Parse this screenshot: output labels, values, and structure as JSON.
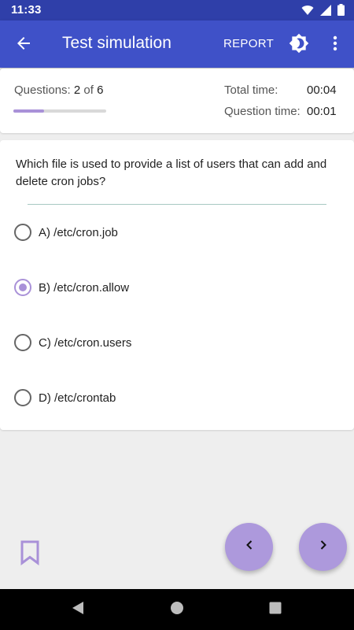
{
  "status_bar": {
    "time": "11:33",
    "icons": [
      "wifi-icon",
      "signal-icon",
      "battery-icon"
    ]
  },
  "app_bar": {
    "title": "Test simulation",
    "report_label": "REPORT",
    "icons": [
      "back-arrow-icon",
      "brightness-icon",
      "more-vert-icon"
    ]
  },
  "progress": {
    "label": "Questions:",
    "current": "2",
    "of_word": "of",
    "total": "6",
    "fraction": 0.333,
    "total_time_label": "Total time:",
    "total_time_value": "00:04",
    "question_time_label": "Question time:",
    "question_time_value": "00:01"
  },
  "question": {
    "text": "Which file is used to provide a list of users that can add and delete cron jobs?",
    "options": [
      {
        "label": "A) /etc/cron.job",
        "selected": false
      },
      {
        "label": "B) /etc/cron.allow",
        "selected": true
      },
      {
        "label": "C) /etc/cron.users",
        "selected": false
      },
      {
        "label": "D) /etc/crontab",
        "selected": false
      }
    ]
  },
  "bottom": {
    "icons": [
      "bookmark-icon",
      "chevron-left-icon",
      "chevron-right-icon"
    ]
  },
  "colors": {
    "app_bar": "#3f51c8",
    "status_bar": "#2f3fa9",
    "accent": "#a991d8",
    "fab": "#ad99dc"
  }
}
